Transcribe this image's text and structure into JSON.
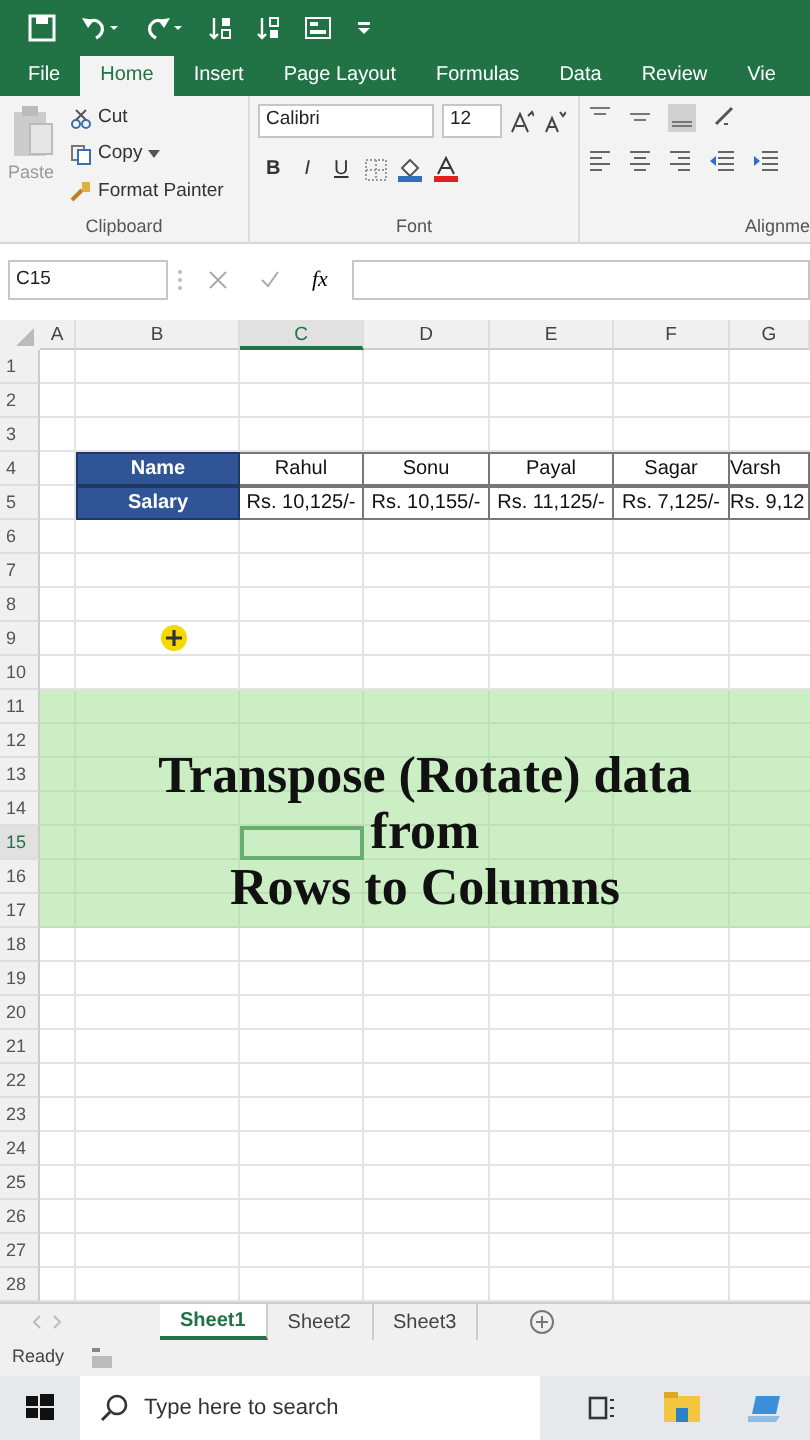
{
  "ribbon_tabs": [
    {
      "label": "File",
      "selected": false
    },
    {
      "label": "Home",
      "selected": true
    },
    {
      "label": "Insert",
      "selected": false
    },
    {
      "label": "Page Layout",
      "selected": false
    },
    {
      "label": "Formulas",
      "selected": false
    },
    {
      "label": "Data",
      "selected": false
    },
    {
      "label": "Review",
      "selected": false
    },
    {
      "label": "Vie",
      "selected": false
    }
  ],
  "clipboard": {
    "paste": "Paste",
    "cut": "Cut",
    "copy": "Copy",
    "format_painter": "Format Painter",
    "group": "Clipboard"
  },
  "font": {
    "name": "Calibri",
    "size": "12",
    "bold": "B",
    "italic": "I",
    "underline": "U",
    "group": "Font"
  },
  "alignment": {
    "group": "Alignme"
  },
  "formula_bar": {
    "name_box": "C15",
    "fx": "fx"
  },
  "columns": [
    {
      "label": "A",
      "selected": false
    },
    {
      "label": "B",
      "selected": false
    },
    {
      "label": "C",
      "selected": true
    },
    {
      "label": "D",
      "selected": false
    },
    {
      "label": "E",
      "selected": false
    },
    {
      "label": "F",
      "selected": false
    },
    {
      "label": "G",
      "selected": false
    }
  ],
  "rows": [
    {
      "number": "1",
      "selected": false
    },
    {
      "number": "2",
      "selected": false
    },
    {
      "number": "3",
      "selected": false
    },
    {
      "number": "4",
      "selected": false,
      "label": "Name",
      "values": [
        "Rahul",
        "Sonu",
        "Payal",
        "Sagar",
        "Varsh"
      ]
    },
    {
      "number": "5",
      "selected": false,
      "label": "Salary",
      "values": [
        "Rs. 10,125/-",
        "Rs. 10,155/-",
        "Rs. 11,125/-",
        "Rs. 7,125/-",
        "Rs. 9,12"
      ]
    },
    {
      "number": "6",
      "selected": false
    },
    {
      "number": "7",
      "selected": false
    },
    {
      "number": "8",
      "selected": false
    },
    {
      "number": "9",
      "selected": false
    },
    {
      "number": "10",
      "selected": false
    },
    {
      "number": "11",
      "selected": false
    },
    {
      "number": "12",
      "selected": false
    },
    {
      "number": "13",
      "selected": false
    },
    {
      "number": "14",
      "selected": false
    },
    {
      "number": "15",
      "selected": true
    },
    {
      "number": "16",
      "selected": false
    },
    {
      "number": "17",
      "selected": false
    },
    {
      "number": "18",
      "selected": false
    },
    {
      "number": "19",
      "selected": false
    },
    {
      "number": "20",
      "selected": false
    },
    {
      "number": "21",
      "selected": false
    },
    {
      "number": "22",
      "selected": false
    },
    {
      "number": "23",
      "selected": false
    },
    {
      "number": "24",
      "selected": false
    },
    {
      "number": "25",
      "selected": false
    },
    {
      "number": "26",
      "selected": false
    },
    {
      "number": "27",
      "selected": false
    },
    {
      "number": "28",
      "selected": false
    }
  ],
  "banner": {
    "lines": [
      "Transpose (Rotate) data",
      "from",
      "Rows to Columns"
    ]
  },
  "sheet_tabs": [
    {
      "label": "Sheet1",
      "selected": true
    },
    {
      "label": "Sheet2",
      "selected": false
    },
    {
      "label": "Sheet3",
      "selected": false
    }
  ],
  "status_bar": {
    "text": "Ready"
  },
  "taskbar": {
    "search_placeholder": "Type here to search"
  }
}
